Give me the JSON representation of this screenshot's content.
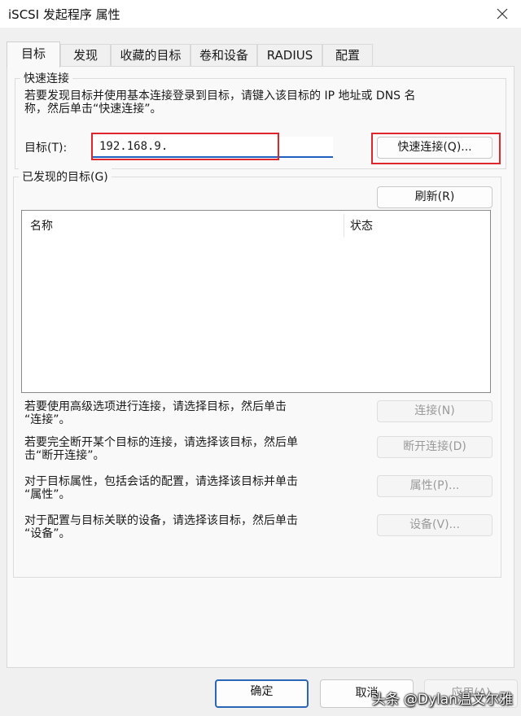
{
  "window": {
    "title": "iSCSI 发起程序 属性",
    "close_icon": "close-icon"
  },
  "tabs": [
    "目标",
    "发现",
    "收藏的目标",
    "卷和设备",
    "RADIUS",
    "配置"
  ],
  "quick_connect": {
    "legend": "快速连接",
    "description_line1": "若要发现目标并使用基本连接登录到目标，请键入该目标的 IP 地址或 DNS 名",
    "description_line2": "称，然后单击“快速连接”。",
    "target_label": "目标(T):",
    "target_value": "192.168.9.",
    "button_label": "快速连接(Q)..."
  },
  "discovered": {
    "legend": "已发现的目标(G)",
    "refresh_label": "刷新(R)",
    "columns": [
      "名称",
      "状态"
    ],
    "rows": []
  },
  "actions": [
    {
      "line1": "若要使用高级选项进行连接，请选择目标，然后单击",
      "line2": "“连接”。",
      "button": "连接(N)"
    },
    {
      "line1": "若要完全断开某个目标的连接，请选择该目标，然后单",
      "line2": "击“断开连接”。",
      "button": "断开连接(D)"
    },
    {
      "line1": "对于目标属性，包括会话的配置，请选择该目标并单击",
      "line2": "“属性”。",
      "button": "属性(P)..."
    },
    {
      "line1": "对于配置与目标关联的设备，请选择该目标，然后单击",
      "line2": "“设备”。",
      "button": "设备(V)..."
    }
  ],
  "footer": {
    "ok": "确定",
    "cancel": "取消",
    "apply": "应用(A)"
  },
  "watermark": "头条 @Dylan温文尔雅",
  "colors": {
    "highlight": "#e0262d",
    "accent": "#2a66b3",
    "input_underline": "#1f5fbf"
  }
}
